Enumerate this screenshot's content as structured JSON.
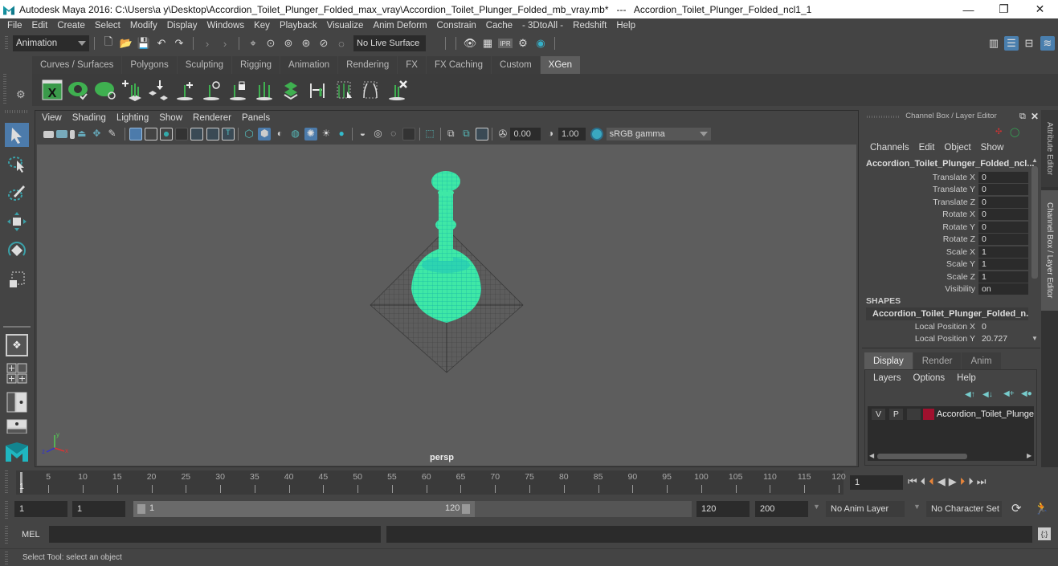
{
  "window": {
    "title": "Autodesk Maya 2016: C:\\Users\\a y\\Desktop\\Accordion_Toilet_Plunger_Folded_max_vray\\Accordion_Toilet_Plunger_Folded_mb_vray.mb*   ---   Accordion_Toilet_Plunger_Folded_ncl1_1",
    "minimize": "—",
    "restore": "❐",
    "close": "✕"
  },
  "menubar": [
    "File",
    "Edit",
    "Create",
    "Select",
    "Modify",
    "Display",
    "Windows",
    "Key",
    "Playback",
    "Visualize",
    "Anim Deform",
    "Constrain",
    "Cache",
    "- 3DtoAll -",
    "Redshift",
    "Help"
  ],
  "statusline": {
    "mode": "Animation",
    "live_surface": "No Live Surface"
  },
  "shelf": {
    "tabs": [
      "Curves / Surfaces",
      "Polygons",
      "Sculpting",
      "Rigging",
      "Animation",
      "Rendering",
      "FX",
      "FX Caching",
      "Custom",
      "XGen"
    ],
    "active_tab": "XGen",
    "icons": [
      "xgen-editor-icon",
      "xgen-preview-icon",
      "xgen-clear-preview-icon",
      "add-guides-icon",
      "place-guides-icon",
      "add-guide-icon",
      "show-guides-icon",
      "lock-guides-icon",
      "rebuild-guides-icon",
      "groom-icon",
      "guide-length-icon",
      "select-guides-icon",
      "normalize-guides-icon",
      "delete-guides-icon"
    ]
  },
  "viewport": {
    "menu": [
      "View",
      "Shading",
      "Lighting",
      "Show",
      "Renderer",
      "Panels"
    ],
    "exposure": "0.00",
    "gamma": "1.00",
    "color_space": "sRGB gamma",
    "camera_label": "persp",
    "axis": {
      "x": "x",
      "y": "y",
      "z": "z"
    }
  },
  "channel_box": {
    "title": "Channel Box / Layer Editor",
    "menu": [
      "Channels",
      "Edit",
      "Object",
      "Show"
    ],
    "object_name": "Accordion_Toilet_Plunger_Folded_ncl...",
    "channels": [
      {
        "label": "Translate X",
        "value": "0"
      },
      {
        "label": "Translate Y",
        "value": "0"
      },
      {
        "label": "Translate Z",
        "value": "0"
      },
      {
        "label": "Rotate X",
        "value": "0"
      },
      {
        "label": "Rotate Y",
        "value": "0"
      },
      {
        "label": "Rotate Z",
        "value": "0"
      },
      {
        "label": "Scale X",
        "value": "1"
      },
      {
        "label": "Scale Y",
        "value": "1"
      },
      {
        "label": "Scale Z",
        "value": "1"
      },
      {
        "label": "Visibility",
        "value": "on"
      }
    ],
    "shapes_header": "SHAPES",
    "shape_name": "Accordion_Toilet_Plunger_Folded_n...",
    "shape_channels": [
      {
        "label": "Local Position X",
        "value": "0"
      },
      {
        "label": "Local Position Y",
        "value": "20.727"
      }
    ]
  },
  "layer_editor": {
    "tabs": [
      "Display",
      "Render",
      "Anim"
    ],
    "active_tab": "Display",
    "menu": [
      "Layers",
      "Options",
      "Help"
    ],
    "layers": [
      {
        "visible": "V",
        "playback": "P",
        "color": "#a0112e",
        "name": "Accordion_Toilet_Plunge"
      }
    ]
  },
  "side_tabs": [
    "Attribute Editor",
    "Channel Box / Layer Editor"
  ],
  "timeline": {
    "ticks": [
      5,
      10,
      15,
      20,
      25,
      30,
      35,
      40,
      45,
      50,
      55,
      60,
      65,
      70,
      75,
      80,
      85,
      90,
      95,
      100,
      105,
      110,
      115,
      120
    ],
    "current_frame_marker": "1",
    "current_frame": "1",
    "range_start": "1",
    "playback_start": "1",
    "slider_start": "1",
    "slider_end": "120",
    "playback_end": "120",
    "range_end": "200",
    "anim_layer": "No Anim Layer",
    "character_set": "No Character Set"
  },
  "command_line": {
    "label": "MEL",
    "input": "",
    "result": ""
  },
  "help_line": "Select Tool: select an object"
}
